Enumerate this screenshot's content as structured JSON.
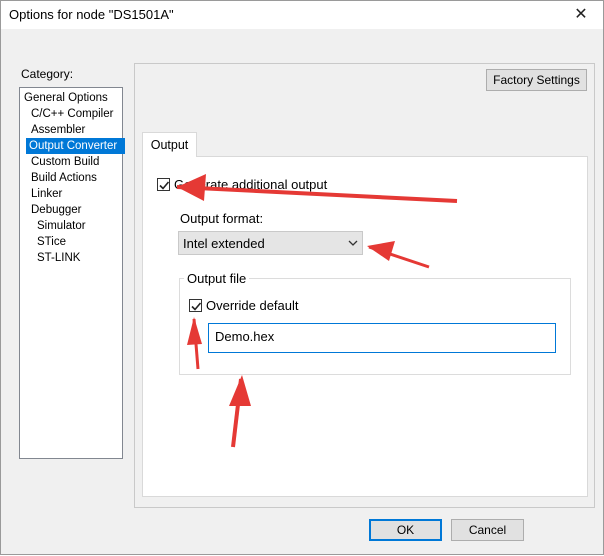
{
  "window": {
    "title": "Options for node \"DS1501A\"",
    "close_glyph": "✕"
  },
  "category": {
    "label": "Category:",
    "items": [
      "General Options",
      "C/C++ Compiler",
      "Assembler",
      "Output Converter",
      "Custom Build",
      "Build Actions",
      "Linker",
      "Debugger",
      "Simulator",
      "STice",
      "ST-LINK"
    ],
    "selected": "Output Converter"
  },
  "factory_settings_label": "Factory Settings",
  "tabs": [
    {
      "label": "Output",
      "active": true
    }
  ],
  "output": {
    "generate_label": "Generate additional output",
    "generate_checked": true,
    "format_label": "Output format:",
    "format_value": "Intel extended",
    "file_group_title": "Output file",
    "override_label": "Override default",
    "override_checked": true,
    "filename_value": "Demo.hex"
  },
  "buttons": {
    "ok": "OK",
    "cancel": "Cancel"
  },
  "colors": {
    "accent": "#0078d7",
    "annotation_arrow": "#e53935"
  }
}
